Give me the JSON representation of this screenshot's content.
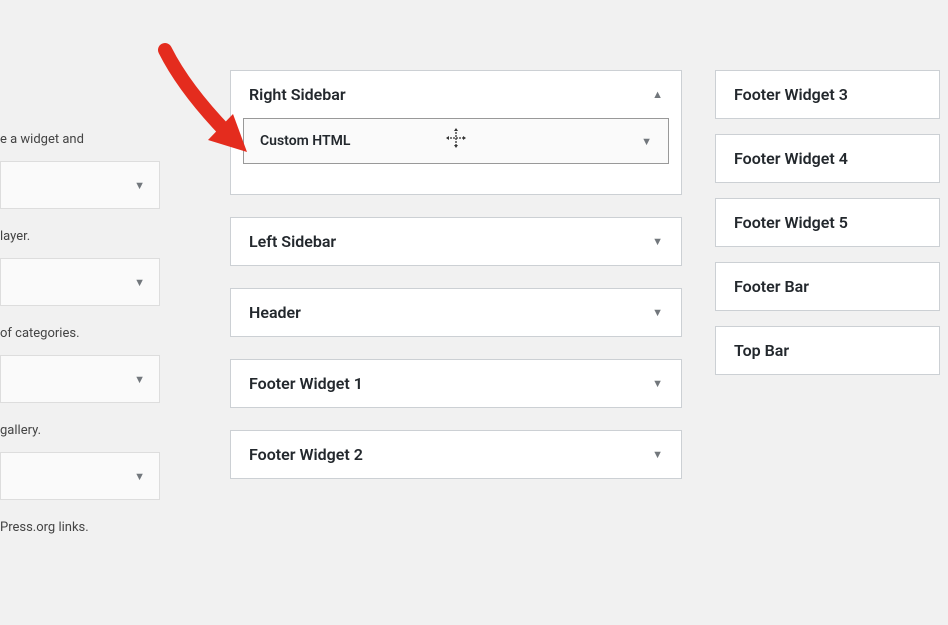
{
  "left": {
    "desc1": "e a widget and",
    "desc2": "layer.",
    "desc3": "of categories.",
    "desc4": "gallery.",
    "desc5": "Press.org links."
  },
  "center": {
    "areas": [
      {
        "title": "Right Sidebar",
        "expanded": true,
        "widget": {
          "name": "Custom HTML"
        }
      },
      {
        "title": "Left Sidebar",
        "expanded": false
      },
      {
        "title": "Header",
        "expanded": false
      },
      {
        "title": "Footer Widget 1",
        "expanded": false
      },
      {
        "title": "Footer Widget 2",
        "expanded": false
      }
    ]
  },
  "right": {
    "areas": [
      {
        "title": "Footer Widget 3"
      },
      {
        "title": "Footer Widget 4"
      },
      {
        "title": "Footer Widget 5"
      },
      {
        "title": "Footer Bar"
      },
      {
        "title": "Top Bar"
      }
    ]
  }
}
